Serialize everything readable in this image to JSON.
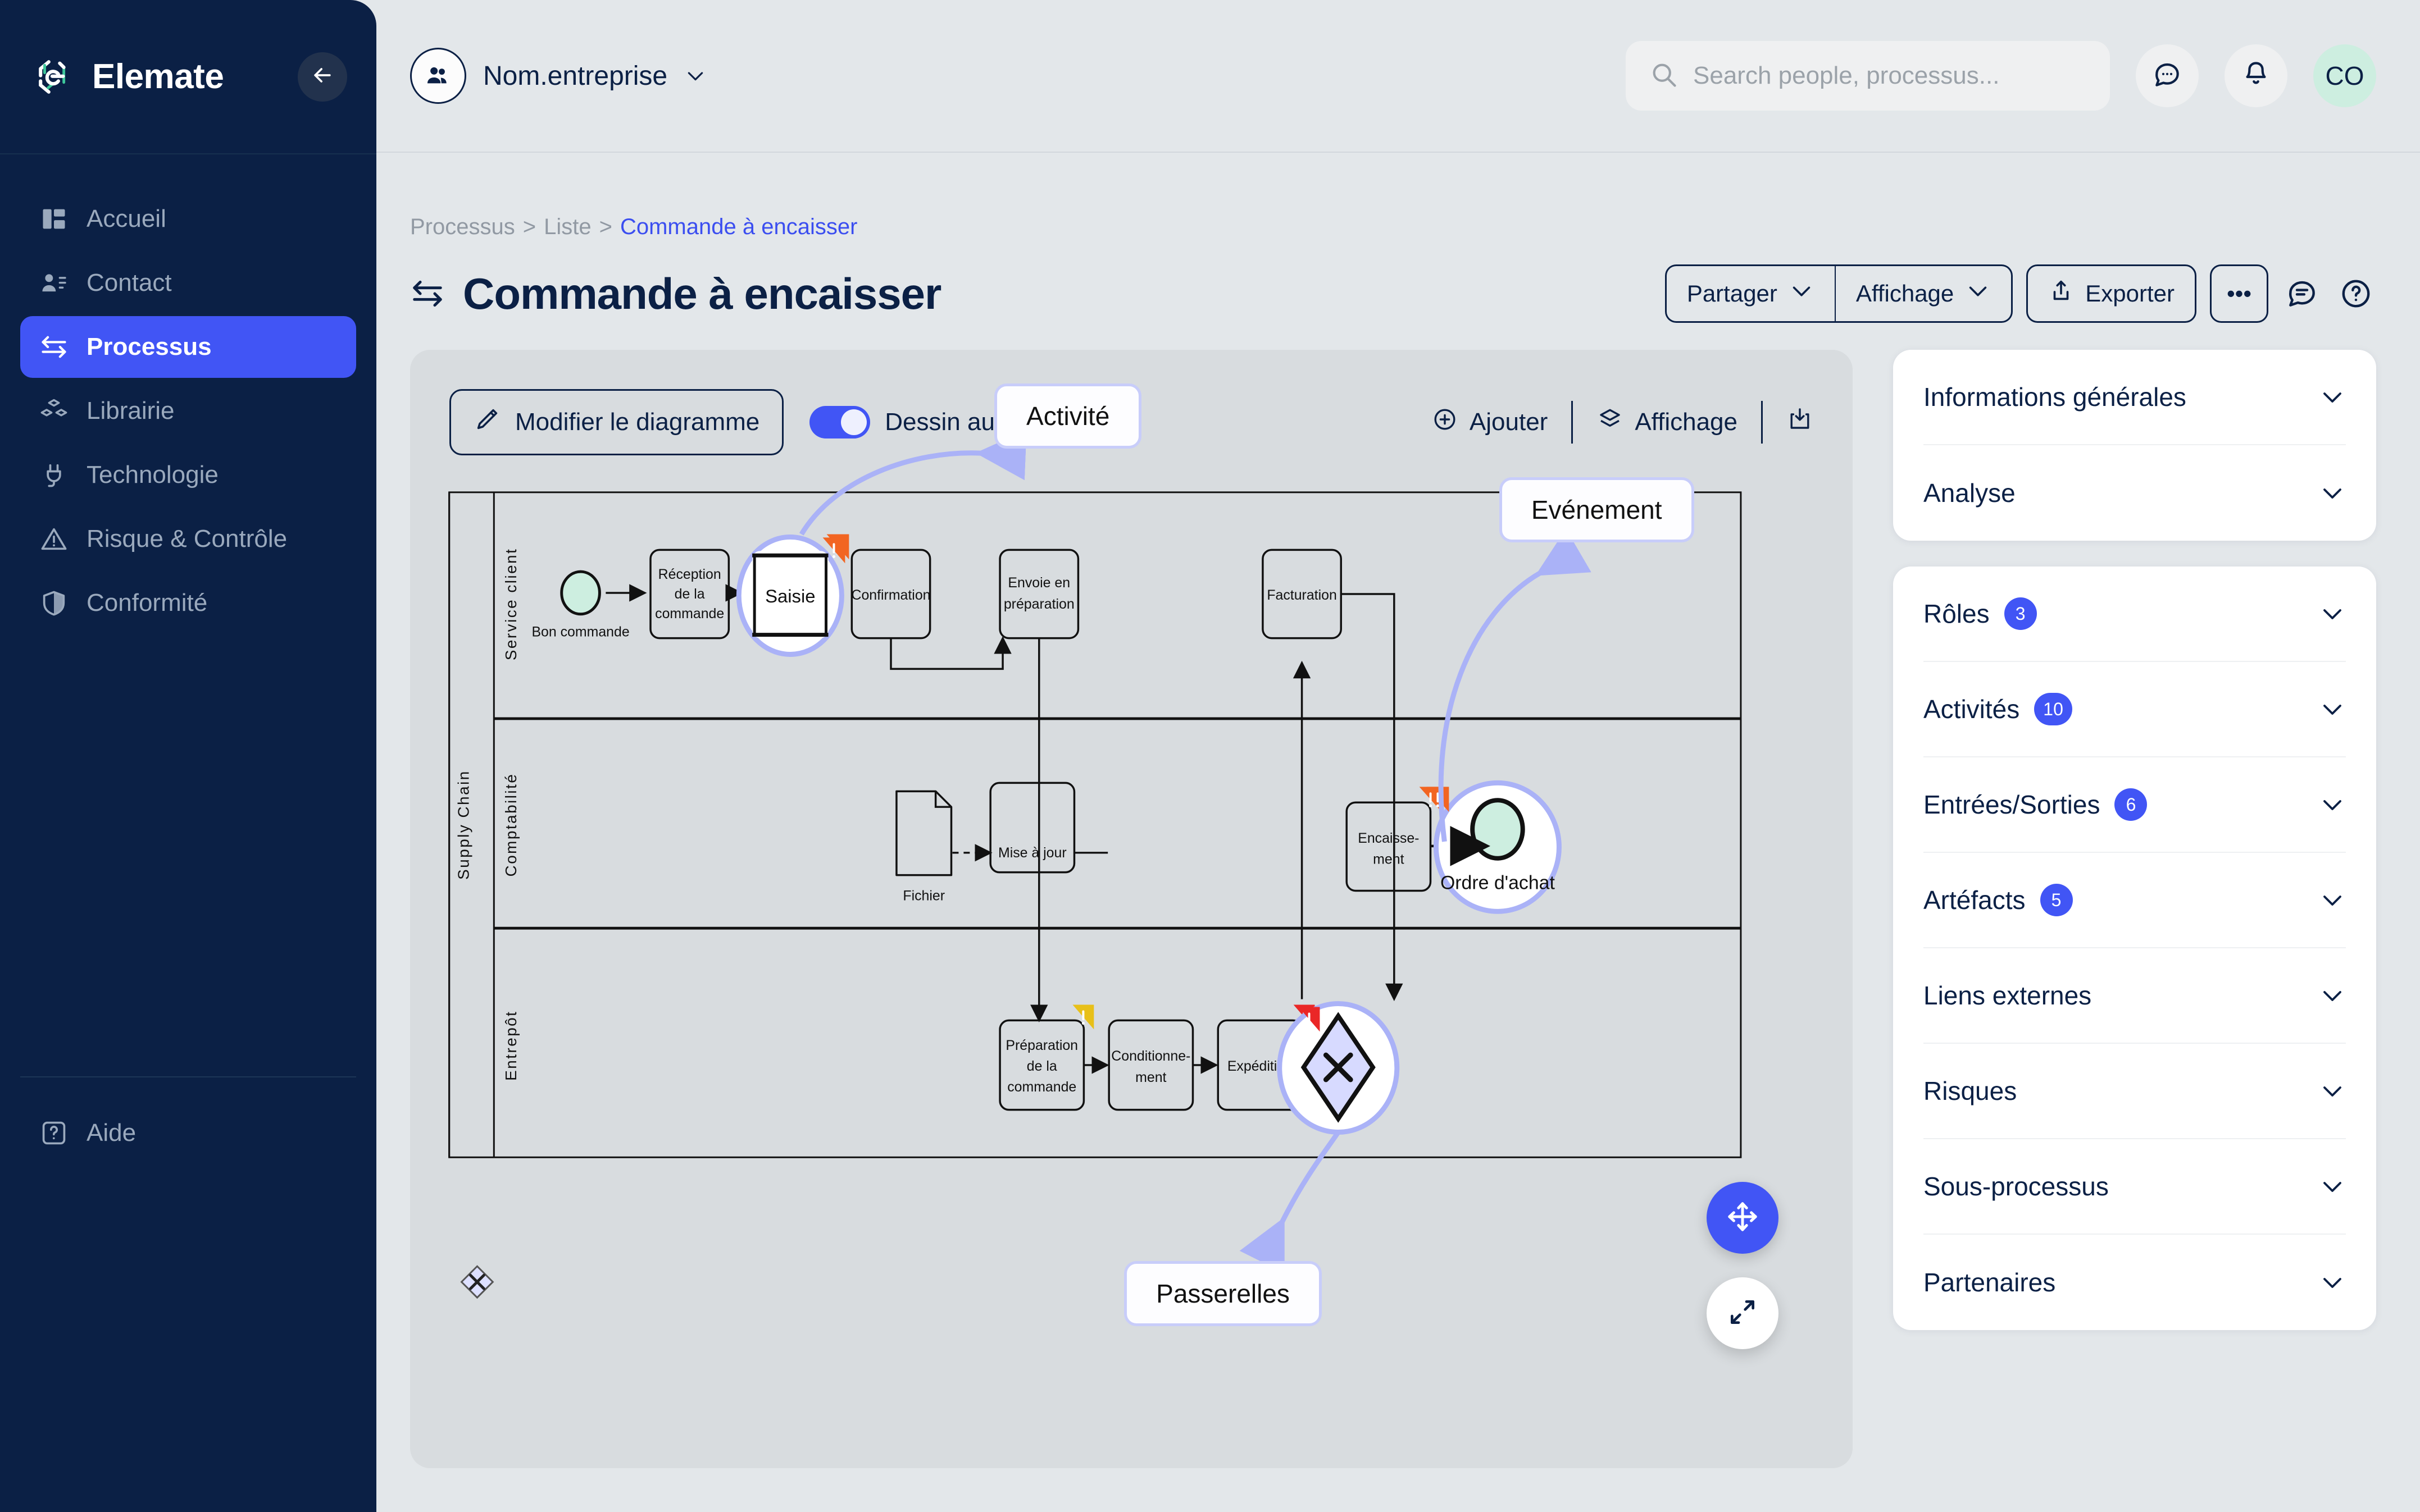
{
  "app": {
    "brand_name": "Elemate"
  },
  "sidebar": {
    "collapse_icon": "arrow-left-icon",
    "items": [
      {
        "label": "Accueil",
        "icon": "dashboard-icon",
        "active": false
      },
      {
        "label": "Contact",
        "icon": "contact-icon",
        "active": false
      },
      {
        "label": "Processus",
        "icon": "process-icon",
        "active": true
      },
      {
        "label": "Librairie",
        "icon": "library-icon",
        "active": false
      },
      {
        "label": "Technologie",
        "icon": "plug-icon",
        "active": false
      },
      {
        "label": "Risque & Contrôle",
        "icon": "warning-icon",
        "active": false
      },
      {
        "label": "Conformité",
        "icon": "shield-icon",
        "active": false
      }
    ],
    "help": {
      "label": "Aide",
      "icon": "help-box-icon"
    }
  },
  "topbar": {
    "org_name": "Nom.entreprise",
    "org_icon": "people-icon",
    "org_chevron": "chevron-down-icon",
    "search": {
      "placeholder": "Search people, processus...",
      "value": "",
      "icon": "search-icon"
    },
    "chat_icon": "chat-bubble-icon",
    "bell_icon": "bell-icon",
    "user_initials": "CO"
  },
  "breadcrumb": {
    "items": [
      "Processus",
      "Liste",
      "Commande à encaisser"
    ],
    "separator": ">"
  },
  "page": {
    "title": "Commande à encaisser",
    "title_icon": "process-icon",
    "actions": {
      "share": "Partager",
      "display": "Affichage",
      "export": "Exporter",
      "more": "•••",
      "comment_icon": "comment-icon",
      "help_icon": "question-circle-icon"
    }
  },
  "canvas_toolbar": {
    "edit_diagram": "Modifier le diagramme",
    "edit_icon": "pencil-icon",
    "auto_draw_label": "Dessin auto.",
    "auto_draw_on": true,
    "add": "Ajouter",
    "add_icon": "plus-circle-icon",
    "display": "Affichage",
    "display_icon": "layers-icon",
    "download_icon": "download-box-icon"
  },
  "floating": {
    "move_icon": "move-arrows-icon",
    "expand_icon": "expand-diagonal-icon"
  },
  "diagram": {
    "callouts": [
      {
        "label": "Activité",
        "target": "Saisie"
      },
      {
        "label": "Evénement",
        "target": "Ordre d'achat"
      },
      {
        "label": "Passerelles",
        "target": "gateway-x"
      }
    ],
    "lanes": [
      {
        "name": "Service client",
        "group": ""
      },
      {
        "name": "Comptabilité",
        "group": "Supply Chain"
      },
      {
        "name": "Entrepôt",
        "group": ""
      }
    ],
    "nodes": [
      {
        "id": "bon",
        "type": "start-event",
        "label": "Bon commande",
        "lane": "Service client"
      },
      {
        "id": "reception",
        "type": "task",
        "label": "Réception de la commande",
        "lane": "Service client"
      },
      {
        "id": "saisie",
        "type": "task",
        "label": "Saisie",
        "lane": "Service client",
        "flag": "orange"
      },
      {
        "id": "confirm",
        "type": "task",
        "label": "Confirmation",
        "lane": "Service client"
      },
      {
        "id": "envoie",
        "type": "task",
        "label": "Envoie en préparation",
        "lane": "Service client"
      },
      {
        "id": "facturation",
        "type": "task",
        "label": "Facturation",
        "lane": "Service client"
      },
      {
        "id": "fichier",
        "type": "artifact",
        "label": "Fichier",
        "lane": "Comptabilité"
      },
      {
        "id": "maj",
        "type": "task",
        "label": "Mise à jour",
        "lane": "Comptabilité"
      },
      {
        "id": "encaisse",
        "type": "task",
        "label": "Encaisse-\nment",
        "lane": "Comptabilité",
        "flag": "orange"
      },
      {
        "id": "ordre",
        "type": "end-event",
        "label": "Ordre d'achat",
        "lane": "Comptabilité"
      },
      {
        "id": "prepa",
        "type": "task",
        "label": "Préparation de la commande",
        "lane": "Entrepôt",
        "flag": "yellow"
      },
      {
        "id": "cond",
        "type": "task",
        "label": "Conditionne-\nment",
        "lane": "Entrepôt"
      },
      {
        "id": "exped",
        "type": "task",
        "label": "Expédition",
        "lane": "Entrepôt",
        "flag": "red"
      },
      {
        "id": "gateway",
        "type": "gateway",
        "label": "X",
        "lane": "Entrepôt"
      },
      {
        "id": "gateway2",
        "type": "gateway",
        "label": "X",
        "lane": "canvas-corner"
      }
    ]
  },
  "right_panel": {
    "group_one": [
      {
        "label": "Informations générales",
        "count": null
      },
      {
        "label": "Analyse",
        "count": null
      }
    ],
    "group_two": [
      {
        "label": "Rôles",
        "count": "3"
      },
      {
        "label": "Activités",
        "count": "10"
      },
      {
        "label": "Entrées/Sorties",
        "count": "6"
      },
      {
        "label": "Artéfacts",
        "count": "5"
      },
      {
        "label": "Liens externes",
        "count": null
      },
      {
        "label": "Risques",
        "count": null
      },
      {
        "label": "Sous-processus",
        "count": null
      },
      {
        "label": "Partenaires",
        "count": null
      }
    ]
  },
  "colors": {
    "sidebar_bg": "#0b2045",
    "accent": "#4155f5",
    "link": "#3b4ef0",
    "page_bg": "#e3e7ea",
    "canvas_bg": "#d8dcdf",
    "event_fill": "#cdeee0",
    "gateway_fill": "#d7daff",
    "callout_border": "#aab2f7",
    "flag_orange": "#f26522",
    "flag_yellow": "#e8c019",
    "flag_red": "#ea2727"
  }
}
